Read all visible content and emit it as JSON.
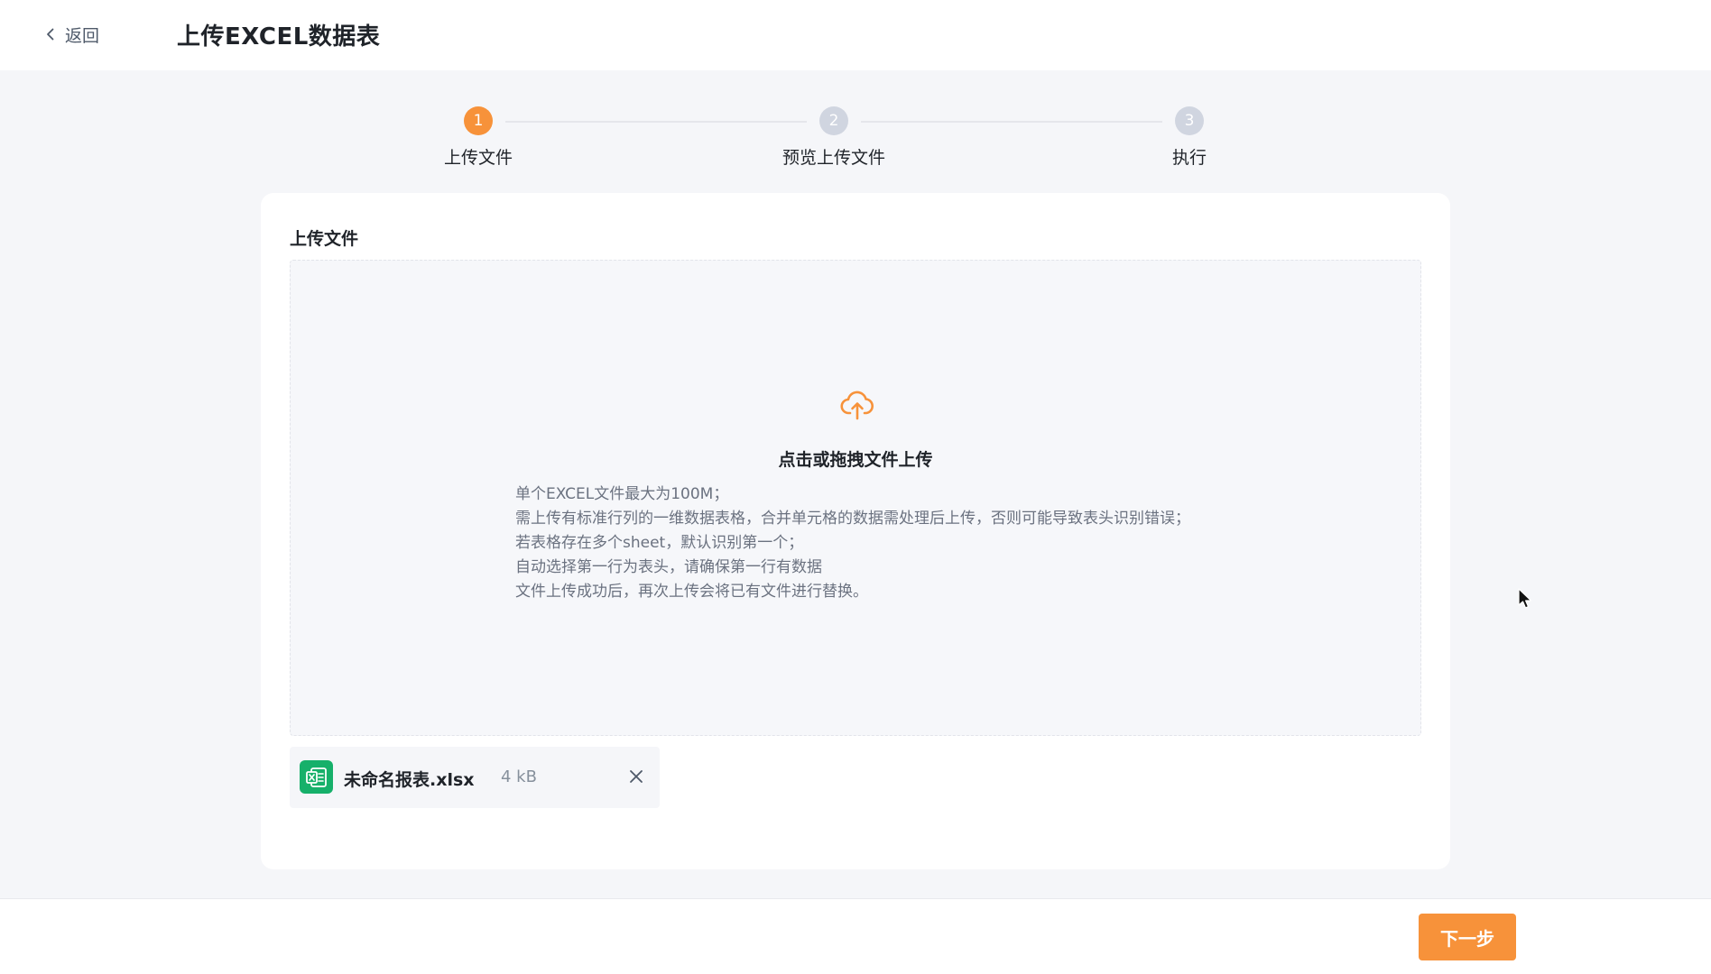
{
  "header": {
    "back_label": "返回",
    "title": "上传EXCEL数据表"
  },
  "steps": [
    {
      "number": "1",
      "label": "上传文件",
      "active": true
    },
    {
      "number": "2",
      "label": "预览上传文件",
      "active": false
    },
    {
      "number": "3",
      "label": "执行",
      "active": false
    }
  ],
  "upload": {
    "section_title": "上传文件",
    "drop_title": "点击或拖拽文件上传",
    "hints": [
      "单个EXCEL文件最大为100M；",
      "需上传有标准行列的一维数据表格，合并单元格的数据需处理后上传，否则可能导致表头识别错误；",
      "若表格存在多个sheet，默认识别第一个；",
      "自动选择第一行为表头，请确保第一行有数据",
      "文件上传成功后，再次上传会将已有文件进行替换。"
    ]
  },
  "file": {
    "name": "未命名报表.xlsx",
    "size": "4 kB"
  },
  "footer": {
    "next_label": "下一步"
  },
  "colors": {
    "accent": "#f7923a",
    "file_icon": "#16b06a",
    "step_inactive": "#d0d5e0"
  }
}
